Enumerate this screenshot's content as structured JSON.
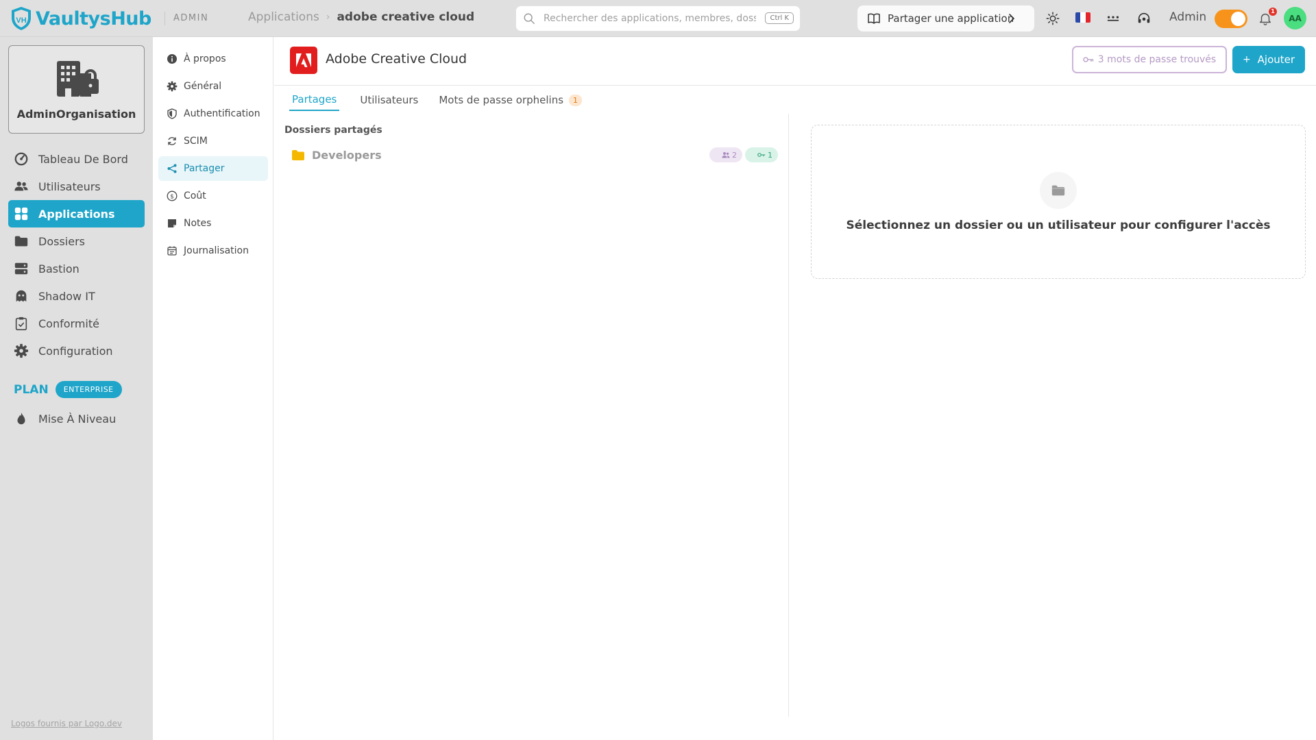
{
  "brand": {
    "name": "VaultysHub",
    "color": "#1ea5c9"
  },
  "header": {
    "section_tag": "ADMIN",
    "breadcrumb": {
      "parent": "Applications",
      "separator": "›",
      "current": "adobe creative cloud"
    },
    "search": {
      "placeholder": "Rechercher des applications, membres, dossiers…",
      "shortcut": "Ctrl K"
    },
    "share_app_label": "Partager une application",
    "language_flag": "fr",
    "user_role_label": "Admin",
    "notifications_count": "1",
    "avatar_initials": "AA"
  },
  "sidebar": {
    "org_name": "AdminOrganisation",
    "items": [
      {
        "label": "Tableau De Bord",
        "icon": "dashboard-icon"
      },
      {
        "label": "Utilisateurs",
        "icon": "users-icon"
      },
      {
        "label": "Applications",
        "icon": "grid-icon",
        "active": true
      },
      {
        "label": "Dossiers",
        "icon": "folder-icon"
      },
      {
        "label": "Bastion",
        "icon": "server-icon"
      },
      {
        "label": "Shadow IT",
        "icon": "ghost-icon"
      },
      {
        "label": "Conformité",
        "icon": "clipboard-check-icon"
      },
      {
        "label": "Configuration",
        "icon": "gear-icon"
      }
    ],
    "plan_label": "PLAN",
    "plan_badge": "ENTERPRISE",
    "upgrade_label": "Mise À Niveau",
    "footer_link": "Logos fournis par Logo.dev"
  },
  "subnav": {
    "items": [
      {
        "label": "À propos",
        "icon": "info-icon"
      },
      {
        "label": "Général",
        "icon": "gear-icon"
      },
      {
        "label": "Authentification",
        "icon": "shield-icon"
      },
      {
        "label": "SCIM",
        "icon": "sync-icon"
      },
      {
        "label": "Partager",
        "icon": "share-icon",
        "active": true
      },
      {
        "label": "Coût",
        "icon": "dollar-icon"
      },
      {
        "label": "Notes",
        "icon": "note-icon"
      },
      {
        "label": "Journalisation",
        "icon": "calendar-icon"
      }
    ]
  },
  "app": {
    "title": "Adobe Creative Cloud",
    "logo_color": "#e21d1d",
    "passwords_found_label": "3 mots de passe trouvés",
    "add_label": "Ajouter",
    "add_symbol": "+"
  },
  "tabs": [
    {
      "label": "Partages",
      "active": true
    },
    {
      "label": "Utilisateurs"
    },
    {
      "label": "Mots de passe orphelins",
      "badge": "1"
    }
  ],
  "shared_folders": {
    "title": "Dossiers partagés",
    "folders": [
      {
        "name": "Developers",
        "users_count": "2",
        "keys_count": "1",
        "folder_color": "#f5b800"
      }
    ]
  },
  "empty_state": {
    "message": "Sélectionnez un dossier ou un utilisateur pour configurer l'accès"
  }
}
